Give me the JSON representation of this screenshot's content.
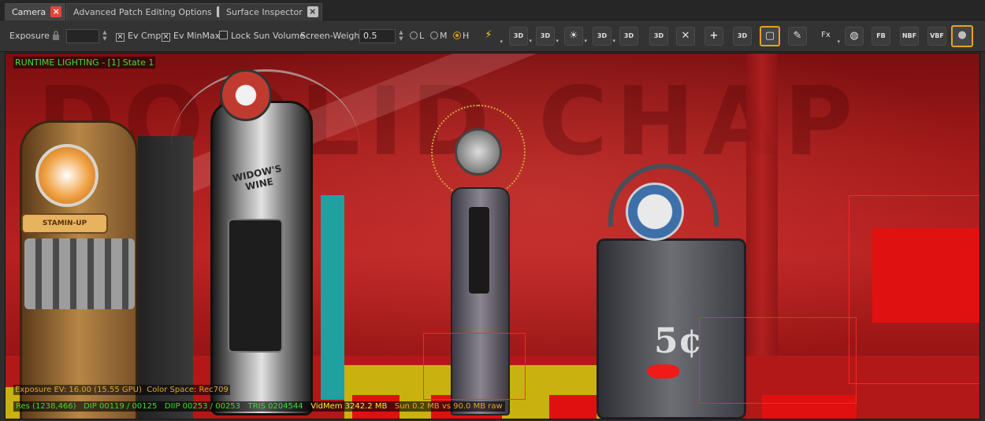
{
  "tabs": [
    {
      "label": "Camera",
      "active": true
    },
    {
      "label": "Advanced Patch Editing Options",
      "active": false
    },
    {
      "label": "Surface Inspector",
      "active": false
    }
  ],
  "toolbar": {
    "exposure_label": "Exposure",
    "exposure_value": "",
    "ev_cmp_label": "Ev Cmp",
    "ev_cmp_checked": true,
    "ev_minmax_label": "Ev MinMax",
    "ev_minmax_checked": true,
    "lock_sun_label": "Lock Sun Volume",
    "lock_sun_checked": false,
    "screen_weight_label": "Screen-Weight",
    "screen_weight_value": "0.5",
    "lod_options": [
      "L",
      "M",
      "H"
    ],
    "lod_selected": "H",
    "icons": [
      {
        "name": "lightning-icon",
        "text": "⚡"
      },
      {
        "name": "camera-3d-icon",
        "text": "3D"
      },
      {
        "name": "view-3d-icon",
        "text": "3D"
      },
      {
        "name": "sun-icon",
        "text": "☀"
      },
      {
        "name": "box-3d-icon",
        "text": "3D"
      },
      {
        "name": "locked-3d-icon",
        "text": "3D"
      },
      {
        "name": "grid-3d-icon",
        "text": "3D"
      },
      {
        "name": "grid-remove-icon",
        "text": "✕"
      },
      {
        "name": "grid-add-icon",
        "text": "+"
      },
      {
        "name": "cube-3d-icon",
        "text": "3D"
      },
      {
        "name": "frame-icon",
        "text": "▢"
      },
      {
        "name": "pencil-icon",
        "text": "✎"
      },
      {
        "name": "fx-icon",
        "text": "Fx"
      },
      {
        "name": "wireframe-sphere-icon",
        "text": "◍"
      },
      {
        "name": "fb-icon",
        "text": "FB"
      },
      {
        "name": "nbf-icon",
        "text": "NBF"
      },
      {
        "name": "vbf-icon",
        "text": "VBF"
      },
      {
        "name": "material-sphere-icon",
        "text": "●"
      }
    ]
  },
  "viewport": {
    "hud_title": "RUNTIME LIGHTING - [1] State 1",
    "exposure_line": "Exposure EV: 16.00 (15.55 GPU)",
    "color_space_line": "Color Space: Rec709",
    "stats": {
      "res": "Res (1238,466)",
      "dip": "DIP 00119 / 00125",
      "diip": "DIIP 00253 / 00253",
      "tris": "TRIS 0204544",
      "vidmem": "VidMem 3242.2 MB",
      "sun": "Sun 0.2 MB vs 90.0 MB raw"
    },
    "machine_labels": {
      "stamin_up": "STAMIN-UP",
      "widows_wine": "WIDOW'S WINE",
      "price": "5¢"
    }
  },
  "colors": {
    "active_tab_close": "#e8433a",
    "selected_tool_border": "#e8a21e",
    "hud_green": "#33e033",
    "hud_orange": "#e8a32c",
    "hud_yellow": "#f0f040",
    "viewport_red": "#b82020"
  }
}
